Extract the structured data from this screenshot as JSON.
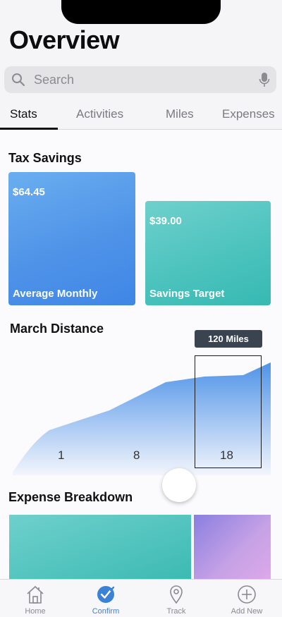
{
  "header": {
    "title": "Overview"
  },
  "search": {
    "placeholder": "Search",
    "icon": "search-icon",
    "mic_icon": "microphone-icon"
  },
  "tabs": [
    {
      "label": "Stats",
      "active": true
    },
    {
      "label": "Activities",
      "active": false
    },
    {
      "label": "Miles",
      "active": false
    },
    {
      "label": "Expenses",
      "active": false
    }
  ],
  "tax_savings": {
    "title": "Tax Savings",
    "cards": [
      {
        "amount": "$64.45",
        "label": "Average Monthly",
        "color": "#4f93e8"
      },
      {
        "amount": "$39.00",
        "label": "Savings Target",
        "color": "#4dc3be"
      }
    ]
  },
  "march_distance": {
    "title": "March Distance",
    "tooltip": "120 Miles",
    "x_labels": [
      "1",
      "8",
      "18"
    ],
    "accent": "#4f93e8"
  },
  "expense_breakdown": {
    "title": "Expense Breakdown",
    "colors": [
      "#4dc3be",
      "#a98fe3"
    ]
  },
  "tabbar": [
    {
      "label": "Home",
      "icon": "home-icon",
      "active": false
    },
    {
      "label": "Confirm",
      "icon": "checkmark-circle-icon",
      "active": true
    },
    {
      "label": "Track",
      "icon": "location-pin-icon",
      "active": false
    },
    {
      "label": "Add New",
      "icon": "plus-circle-icon",
      "active": false
    }
  ],
  "colors": {
    "accent": "#3b82d6"
  }
}
